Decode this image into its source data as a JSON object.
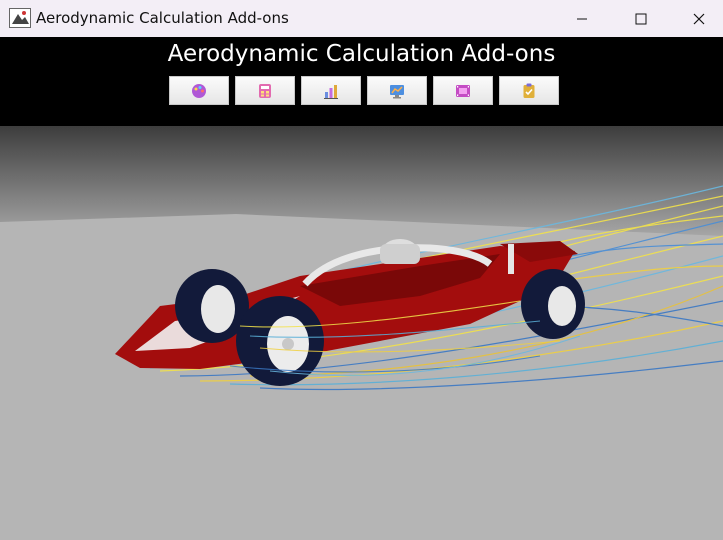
{
  "window": {
    "title": "Aerodynamic Calculation Add-ons",
    "controls": [
      "minimize",
      "maximize",
      "close"
    ]
  },
  "header": {
    "title": "Aerodynamic Calculation Add-ons"
  },
  "toolbar": {
    "buttons": [
      {
        "icon": "palette-icon",
        "color": "#b058d6"
      },
      {
        "icon": "calculator-icon",
        "color": "#e26bb0"
      },
      {
        "icon": "bar-chart-icon",
        "color": "#6b8ee0"
      },
      {
        "icon": "monitor-chart-icon",
        "color": "#e07a3a"
      },
      {
        "icon": "film-icon",
        "color": "#c44cc4"
      },
      {
        "icon": "clipboard-icon",
        "color": "#e0b03a"
      }
    ]
  },
  "scene": {
    "description_icon": "f1-car-streamlines",
    "colors": {
      "car": "#a30d0d",
      "floor": "#b5b5b5",
      "sky_top": "#4a4a4a"
    }
  }
}
